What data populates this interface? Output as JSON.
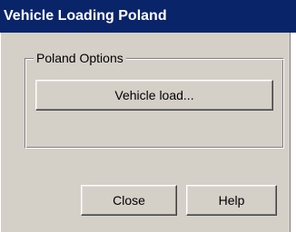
{
  "window": {
    "title": "Vehicle Loading Poland"
  },
  "group": {
    "label": "Poland Options"
  },
  "buttons": {
    "vehicle_load": "Vehicle load...",
    "close": "Close",
    "help": "Help"
  },
  "colors": {
    "titlebar": "#0a246a",
    "dialog_face": "#d4d0c8"
  }
}
